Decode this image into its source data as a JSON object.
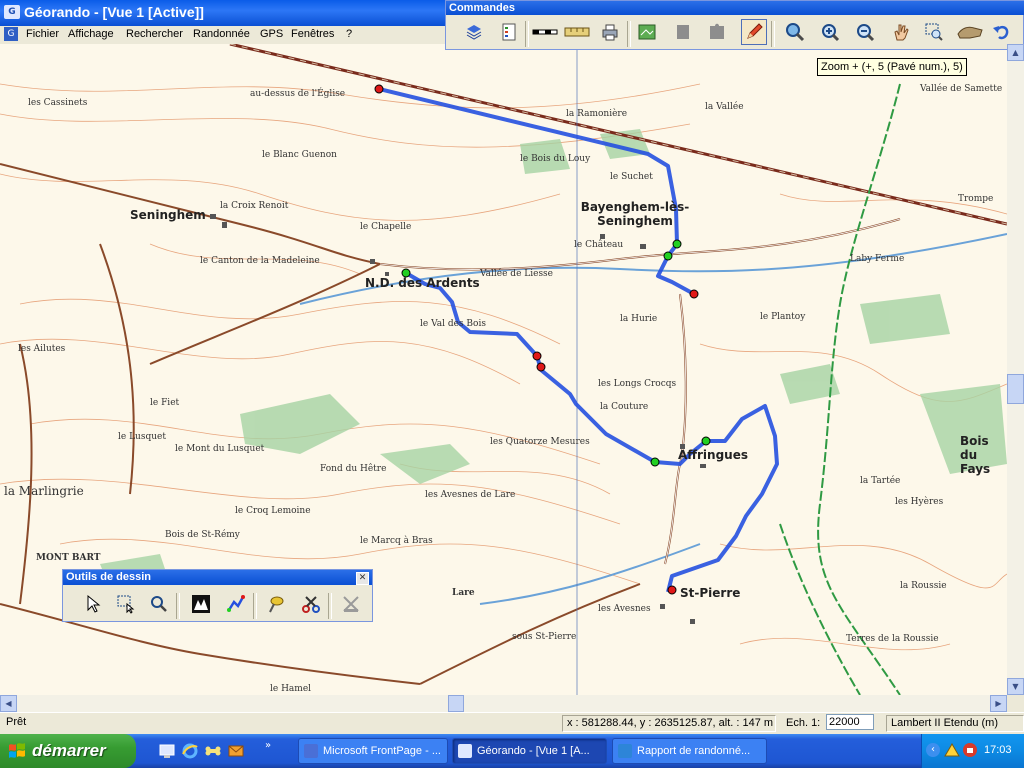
{
  "window": {
    "title": "Géorando - [Vue 1 [Active]]",
    "app_icon": "georando-icon"
  },
  "menu": [
    "Fichier",
    "Affichage",
    "Rechercher",
    "Randonnée",
    "GPS",
    "Fenêtres",
    "?"
  ],
  "commands": {
    "title": "Commandes",
    "buttons": [
      "layers-icon",
      "legend-icon",
      "scale-bar-icon",
      "ruler-icon",
      "print-icon",
      "map-export-icon",
      "shape-icon",
      "puzzle-icon",
      "pencil-icon",
      "magnifier-icon",
      "zoom-in-icon",
      "zoom-out-icon",
      "hand-icon",
      "zoom-window-icon",
      "pan-icon",
      "undo-icon"
    ],
    "tooltip": "Zoom + (+, 5 (Pavé num.), 5)"
  },
  "map": {
    "labels": [
      "Seninghem",
      "Bayenghem-lès-Seninghem",
      "N.D. des Ardents",
      "Affringues",
      "St-Pierre",
      "Bois du Fays",
      "le Chapelle",
      "le Canton de la Madeleine",
      "Vallée de Liesse",
      "le Val des Bois",
      "la Hurie",
      "les Quatorze Mesures",
      "la Couture",
      "Fond du Hêtre",
      "les Avesnes de Lare",
      "le Croq Lemoine",
      "Bois de St-Rémy",
      "le Marcq à Bras",
      "MONT BART",
      "le Hamel",
      "Lare",
      "Terres de la Roussie",
      "les Hyères",
      "la Tartée",
      "la Ramonière",
      "la Vallée",
      "le Suchet",
      "le Château",
      "les Longs Crocqs",
      "le Fiet",
      "le Lusquet",
      "la Marlingrie",
      "le Mont du Lusquet",
      "les Ailutes",
      "les Cassinets",
      "sous St-Pierre",
      "les Avesnes",
      "Trompe",
      "la Roussie",
      "Vallée de Samette",
      "le Blanc Guenon",
      "la Croix Renoit",
      "le Bois du Louy",
      "au-dessus de l'Église",
      "Laby Ferme",
      "le Plantoy"
    ]
  },
  "drawing_tools": {
    "title": "Outils de dessin",
    "buttons": [
      "pointer-icon",
      "select-rectangle-icon",
      "select-zoom-icon",
      "terrain-icon",
      "route-icon",
      "pin-icon",
      "cut-icon",
      "erase-icon"
    ]
  },
  "status": {
    "ready": "Prêt",
    "coords": "x : 581288.44, y : 2635125.87, alt. : 147 m",
    "scale_label": "Ech. 1:",
    "scale_value": "22000",
    "projection": "Lambert II Etendu (m)"
  },
  "taskbar": {
    "start": "démarrer",
    "quicklaunch": [
      "desktop-icon",
      "ie-icon",
      "bone-icon",
      "mail-icon"
    ],
    "tasks": [
      {
        "label": "Microsoft FrontPage - ...",
        "active": false,
        "color": "#4a6fd6"
      },
      {
        "label": "Géorando - [Vue 1 [A...",
        "active": true,
        "color": "#3760c8"
      },
      {
        "label": "Rapport de randonné...",
        "active": false,
        "color": "#2d85d8"
      }
    ],
    "clock": "17:03"
  }
}
